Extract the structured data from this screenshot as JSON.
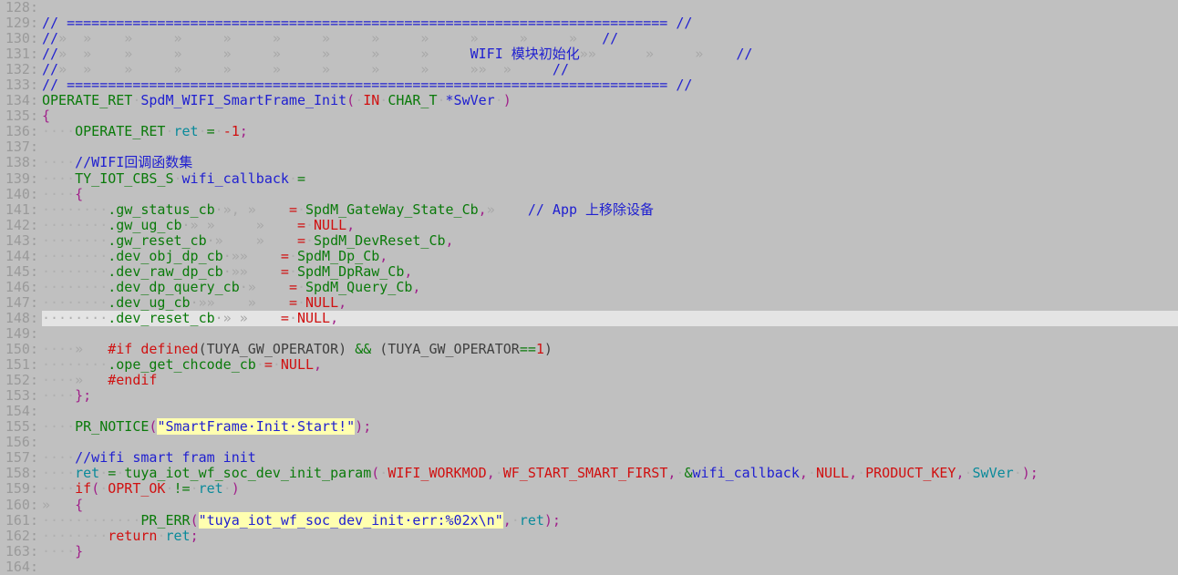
{
  "editor": {
    "background": "#c0c0c0",
    "current_line": 148,
    "first_line": 128,
    "last_line": 164,
    "colors": {
      "comment": "#2020d0",
      "type": "#0a7a0a",
      "keyword": "#d01010",
      "string_fg": "#2020d0",
      "string_bg": "#ffffb0",
      "punctuation": "#a0208a",
      "operator": "#0a7a0a",
      "local_var": "#0a8a9a",
      "line_number": "#9a9a9a",
      "current_line_bg": "#e4e4e4",
      "whitespace_dot": "#b0b0b0",
      "tab_arrow": "#a8a8a8"
    }
  },
  "lines": [
    {
      "num": "128",
      "tokens": []
    },
    {
      "num": "129",
      "tokens": [
        {
          "t": "// ",
          "c": "cmt"
        },
        {
          "t": "=========================================================================",
          "c": "cmt"
        },
        {
          "t": " ",
          "c": "ws-dot"
        },
        {
          "t": "//",
          "c": "cmt"
        }
      ]
    },
    {
      "num": "130",
      "tokens": [
        {
          "t": "//",
          "c": "cmt"
        },
        {
          "t": "»  »    »     »     »     »     »     »     »     »     »     ",
          "c": "tab"
        },
        {
          "t": "»   ",
          "c": "tab"
        },
        {
          "t": "//",
          "c": "cmt"
        }
      ]
    },
    {
      "num": "131",
      "tokens": [
        {
          "t": "//",
          "c": "cmt"
        },
        {
          "t": "»  »    »     »     »     »     »     »     »     ",
          "c": "tab"
        },
        {
          "t": "WIFI 模块初始化",
          "c": "cmt"
        },
        {
          "t": "»»      »     »    ",
          "c": "tab"
        },
        {
          "t": "//",
          "c": "cmt"
        }
      ]
    },
    {
      "num": "132",
      "tokens": [
        {
          "t": "//",
          "c": "cmt"
        },
        {
          "t": "»  »    »     »     »     »     »     »     »     »»  »    ",
          "c": "tab"
        },
        {
          "t": " ",
          "c": "ws-dot"
        },
        {
          "t": "//",
          "c": "cmt"
        }
      ]
    },
    {
      "num": "133",
      "tokens": [
        {
          "t": "// ",
          "c": "cmt"
        },
        {
          "t": "=========================================================================",
          "c": "cmt"
        },
        {
          "t": " ",
          "c": "ws-dot"
        },
        {
          "t": "//",
          "c": "cmt"
        }
      ]
    },
    {
      "num": "134",
      "tokens": [
        {
          "t": "OPERATE_RET",
          "c": "typ"
        },
        {
          "t": "·",
          "c": "ws"
        },
        {
          "t": "SpdM_WIFI_SmartFrame_Init",
          "c": "var"
        },
        {
          "t": "(",
          "c": "pun"
        },
        {
          "t": "·",
          "c": "ws"
        },
        {
          "t": "IN",
          "c": "kw"
        },
        {
          "t": "·",
          "c": "ws"
        },
        {
          "t": "CHAR_T",
          "c": "typ"
        },
        {
          "t": "·",
          "c": "ws"
        },
        {
          "t": "*SwVer",
          "c": "var"
        },
        {
          "t": "·",
          "c": "ws"
        },
        {
          "t": ")",
          "c": "pun"
        }
      ]
    },
    {
      "num": "135",
      "tokens": [
        {
          "t": "{",
          "c": "pun"
        }
      ]
    },
    {
      "num": "136",
      "tokens": [
        {
          "t": "····",
          "c": "ws"
        },
        {
          "t": "OPERATE_RET",
          "c": "typ"
        },
        {
          "t": "·",
          "c": "ws"
        },
        {
          "t": "ret",
          "c": "loc"
        },
        {
          "t": "·",
          "c": "ws"
        },
        {
          "t": "=",
          "c": "op"
        },
        {
          "t": "·",
          "c": "ws"
        },
        {
          "t": "-1",
          "c": "num"
        },
        {
          "t": ";",
          "c": "pun"
        }
      ]
    },
    {
      "num": "137",
      "tokens": []
    },
    {
      "num": "138",
      "tokens": [
        {
          "t": "····",
          "c": "ws"
        },
        {
          "t": "//WIFI回调函数集",
          "c": "cmt"
        }
      ]
    },
    {
      "num": "139",
      "tokens": [
        {
          "t": "····",
          "c": "ws"
        },
        {
          "t": "TY_IOT_CBS_S",
          "c": "typ"
        },
        {
          "t": "·",
          "c": "ws"
        },
        {
          "t": "wifi_callback",
          "c": "var"
        },
        {
          "t": "·",
          "c": "ws"
        },
        {
          "t": "=",
          "c": "op"
        }
      ]
    },
    {
      "num": "140",
      "tokens": [
        {
          "t": "····",
          "c": "ws"
        },
        {
          "t": "{",
          "c": "pun"
        }
      ]
    },
    {
      "num": "141",
      "tokens": [
        {
          "t": "········",
          "c": "ws"
        },
        {
          "t": ".gw_status_cb",
          "c": "typ"
        },
        {
          "t": "·», »    ",
          "c": "tab"
        },
        {
          "t": "=",
          "c": "eq"
        },
        {
          "t": "·",
          "c": "ws"
        },
        {
          "t": "SpdM_GateWay_State_Cb",
          "c": "typ"
        },
        {
          "t": ",",
          "c": "pun"
        },
        {
          "t": "»    ",
          "c": "tab"
        },
        {
          "t": "// App 上移除设备",
          "c": "cmt"
        }
      ]
    },
    {
      "num": "142",
      "tokens": [
        {
          "t": "········",
          "c": "ws"
        },
        {
          "t": ".gw_ug_cb",
          "c": "typ"
        },
        {
          "t": "·» »     »    ",
          "c": "tab"
        },
        {
          "t": "=",
          "c": "eq"
        },
        {
          "t": "·",
          "c": "ws"
        },
        {
          "t": "NULL",
          "c": "kw"
        },
        {
          "t": ",",
          "c": "pun"
        }
      ]
    },
    {
      "num": "143",
      "tokens": [
        {
          "t": "········",
          "c": "ws"
        },
        {
          "t": ".gw_reset_cb",
          "c": "typ"
        },
        {
          "t": "·»    »    ",
          "c": "tab"
        },
        {
          "t": "=",
          "c": "eq"
        },
        {
          "t": "·",
          "c": "ws"
        },
        {
          "t": "SpdM_DevReset_Cb",
          "c": "typ"
        },
        {
          "t": ",",
          "c": "pun"
        }
      ]
    },
    {
      "num": "144",
      "tokens": [
        {
          "t": "········",
          "c": "ws"
        },
        {
          "t": ".dev_obj_dp_cb",
          "c": "typ"
        },
        {
          "t": "·»»    ",
          "c": "tab"
        },
        {
          "t": "=",
          "c": "eq"
        },
        {
          "t": "·",
          "c": "ws"
        },
        {
          "t": "SpdM_Dp_Cb",
          "c": "typ"
        },
        {
          "t": ",",
          "c": "pun"
        }
      ]
    },
    {
      "num": "145",
      "tokens": [
        {
          "t": "········",
          "c": "ws"
        },
        {
          "t": ".dev_raw_dp_cb",
          "c": "typ"
        },
        {
          "t": "·»»    ",
          "c": "tab"
        },
        {
          "t": "=",
          "c": "eq"
        },
        {
          "t": "·",
          "c": "ws"
        },
        {
          "t": "SpdM_DpRaw_Cb",
          "c": "typ"
        },
        {
          "t": ",",
          "c": "pun"
        }
      ]
    },
    {
      "num": "146",
      "tokens": [
        {
          "t": "········",
          "c": "ws"
        },
        {
          "t": ".dev_dp_query_cb",
          "c": "typ"
        },
        {
          "t": "·»    ",
          "c": "tab"
        },
        {
          "t": "=",
          "c": "eq"
        },
        {
          "t": "·",
          "c": "ws"
        },
        {
          "t": "SpdM_Query_Cb",
          "c": "typ"
        },
        {
          "t": ",",
          "c": "pun"
        }
      ]
    },
    {
      "num": "147",
      "tokens": [
        {
          "t": "········",
          "c": "ws"
        },
        {
          "t": ".dev_ug_cb",
          "c": "typ"
        },
        {
          "t": "·»»    »    ",
          "c": "tab"
        },
        {
          "t": "=",
          "c": "eq"
        },
        {
          "t": "·",
          "c": "ws"
        },
        {
          "t": "NULL",
          "c": "kw"
        },
        {
          "t": ",",
          "c": "pun"
        }
      ]
    },
    {
      "num": "148",
      "current": true,
      "tokens": [
        {
          "t": "········",
          "c": "ws"
        },
        {
          "t": ".dev_reset_cb",
          "c": "typ"
        },
        {
          "t": "·» »    ",
          "c": "tab"
        },
        {
          "t": "=",
          "c": "eq"
        },
        {
          "t": "·",
          "c": "ws"
        },
        {
          "t": "NULL",
          "c": "kw"
        },
        {
          "t": ",",
          "c": "pun"
        }
      ]
    },
    {
      "num": "149",
      "tokens": []
    },
    {
      "num": "150",
      "tokens": [
        {
          "t": "····",
          "c": "ws"
        },
        {
          "t": "»   ",
          "c": "tab"
        },
        {
          "t": "#if",
          "c": "kw"
        },
        {
          "t": " ",
          "c": "ws-dot"
        },
        {
          "t": "defined",
          "c": "kw"
        },
        {
          "t": "(TUYA_GW_OPERATOR)",
          "c": "mac"
        },
        {
          "t": " ",
          "c": "ws-dot"
        },
        {
          "t": "&&",
          "c": "op"
        },
        {
          "t": " ",
          "c": "ws-dot"
        },
        {
          "t": "(TUYA_GW_OPERATOR",
          "c": "mac"
        },
        {
          "t": "==",
          "c": "op"
        },
        {
          "t": "1",
          "c": "num"
        },
        {
          "t": ")",
          "c": "mac"
        }
      ]
    },
    {
      "num": "151",
      "tokens": [
        {
          "t": "········",
          "c": "ws"
        },
        {
          "t": ".ope_get_chcode_cb",
          "c": "typ"
        },
        {
          "t": "·",
          "c": "ws"
        },
        {
          "t": "=",
          "c": "eq"
        },
        {
          "t": "·",
          "c": "ws"
        },
        {
          "t": "NULL",
          "c": "kw"
        },
        {
          "t": ",",
          "c": "pun"
        }
      ]
    },
    {
      "num": "152",
      "tokens": [
        {
          "t": "····",
          "c": "ws"
        },
        {
          "t": "»   ",
          "c": "tab"
        },
        {
          "t": "#endif",
          "c": "kw"
        }
      ]
    },
    {
      "num": "153",
      "tokens": [
        {
          "t": "····",
          "c": "ws"
        },
        {
          "t": "};",
          "c": "pun"
        }
      ]
    },
    {
      "num": "154",
      "tokens": []
    },
    {
      "num": "155",
      "tokens": [
        {
          "t": "····",
          "c": "ws"
        },
        {
          "t": "PR_NOTICE",
          "c": "typ"
        },
        {
          "t": "(",
          "c": "pun"
        },
        {
          "t": "\"SmartFrame·Init·Start!\"",
          "c": "str"
        },
        {
          "t": ")",
          "c": "pun"
        },
        {
          "t": ";",
          "c": "pun"
        }
      ]
    },
    {
      "num": "156",
      "tokens": []
    },
    {
      "num": "157",
      "tokens": [
        {
          "t": "····",
          "c": "ws"
        },
        {
          "t": "//wifi smart fram init",
          "c": "cmt"
        }
      ]
    },
    {
      "num": "158",
      "tokens": [
        {
          "t": "····",
          "c": "ws"
        },
        {
          "t": "ret",
          "c": "loc"
        },
        {
          "t": "·",
          "c": "ws"
        },
        {
          "t": "=",
          "c": "op"
        },
        {
          "t": "·",
          "c": "ws"
        },
        {
          "t": "tuya_iot_wf_soc_dev_init_param",
          "c": "typ"
        },
        {
          "t": "(",
          "c": "pun"
        },
        {
          "t": "·",
          "c": "ws"
        },
        {
          "t": "WIFI_WORKMOD",
          "c": "kw"
        },
        {
          "t": ",",
          "c": "pun"
        },
        {
          "t": "·",
          "c": "ws"
        },
        {
          "t": "WF_START_SMART_FIRST",
          "c": "kw"
        },
        {
          "t": ",",
          "c": "pun"
        },
        {
          "t": "·",
          "c": "ws"
        },
        {
          "t": "&",
          "c": "op"
        },
        {
          "t": "wifi_callback",
          "c": "var"
        },
        {
          "t": ",",
          "c": "pun"
        },
        {
          "t": "·",
          "c": "ws"
        },
        {
          "t": "NULL",
          "c": "kw"
        },
        {
          "t": ",",
          "c": "pun"
        },
        {
          "t": "·",
          "c": "ws"
        },
        {
          "t": "PRODUCT_KEY",
          "c": "kw"
        },
        {
          "t": ",",
          "c": "pun"
        },
        {
          "t": "·",
          "c": "ws"
        },
        {
          "t": "SwVer",
          "c": "loc"
        },
        {
          "t": "·",
          "c": "ws"
        },
        {
          "t": ")",
          "c": "pun"
        },
        {
          "t": ";",
          "c": "pun"
        }
      ]
    },
    {
      "num": "159",
      "tokens": [
        {
          "t": "····",
          "c": "ws"
        },
        {
          "t": "if",
          "c": "kw"
        },
        {
          "t": "(",
          "c": "pun"
        },
        {
          "t": "·",
          "c": "ws"
        },
        {
          "t": "OPRT_OK",
          "c": "kw"
        },
        {
          "t": "·",
          "c": "ws"
        },
        {
          "t": "!=",
          "c": "op"
        },
        {
          "t": "·",
          "c": "ws"
        },
        {
          "t": "ret",
          "c": "loc"
        },
        {
          "t": "·",
          "c": "ws"
        },
        {
          "t": ")",
          "c": "pun"
        }
      ]
    },
    {
      "num": "160",
      "tokens": [
        {
          "t": "»   ",
          "c": "tab"
        },
        {
          "t": "{",
          "c": "pun"
        }
      ]
    },
    {
      "num": "161",
      "tokens": [
        {
          "t": "········",
          "c": "ws"
        },
        {
          "t": "····",
          "c": "ws"
        },
        {
          "t": "PR_ERR",
          "c": "typ"
        },
        {
          "t": "(",
          "c": "pun"
        },
        {
          "t": "\"tuya_iot_wf_soc_dev_init·err:%02x\\n\"",
          "c": "str"
        },
        {
          "t": ",",
          "c": "pun"
        },
        {
          "t": "·",
          "c": "ws"
        },
        {
          "t": "ret",
          "c": "loc"
        },
        {
          "t": ")",
          "c": "pun"
        },
        {
          "t": ";",
          "c": "pun"
        }
      ]
    },
    {
      "num": "162",
      "tokens": [
        {
          "t": "········",
          "c": "ws"
        },
        {
          "t": "return",
          "c": "kw"
        },
        {
          "t": "·",
          "c": "ws"
        },
        {
          "t": "ret",
          "c": "loc"
        },
        {
          "t": ";",
          "c": "pun"
        }
      ]
    },
    {
      "num": "163",
      "tokens": [
        {
          "t": "····",
          "c": "ws"
        },
        {
          "t": "}",
          "c": "pun"
        }
      ]
    },
    {
      "num": "164",
      "tokens": []
    }
  ]
}
